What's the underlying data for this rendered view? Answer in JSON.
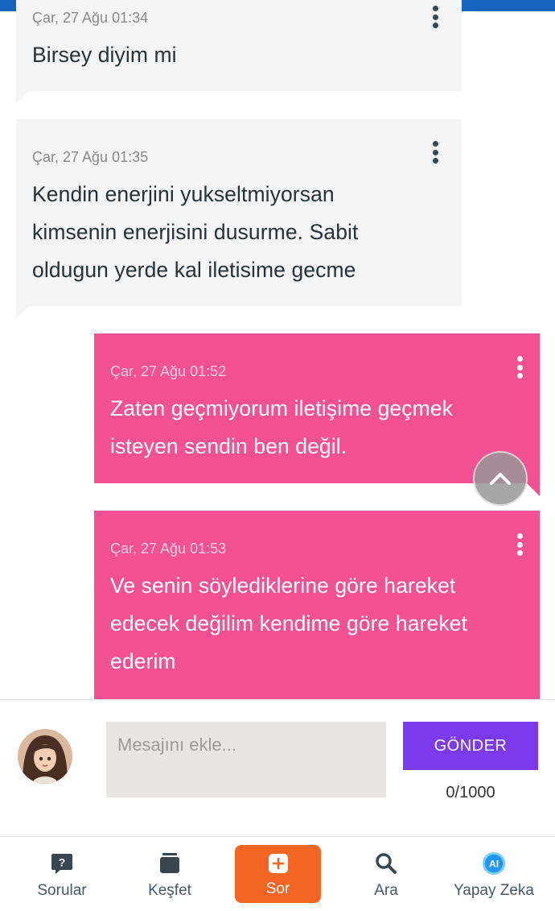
{
  "messages": [
    {
      "direction": "in",
      "time": "Çar, 27 Ağu 01:34",
      "lines": [
        "Birsey diyim mi"
      ]
    },
    {
      "direction": "in",
      "time": "Çar, 27 Ağu 01:35",
      "lines": [
        "Kendin enerjini yukseltmiyorsan",
        "kimsenin enerjisini dusurme. Sabit",
        "oldugun yerde kal iletisime gecme"
      ]
    },
    {
      "direction": "out",
      "time": "Çar, 27 Ağu 01:52",
      "lines": [
        "Zaten geçmiyorum iletişime geçmek",
        "isteyen sendin ben değil."
      ]
    },
    {
      "direction": "out",
      "time": "Çar, 27 Ağu 01:53",
      "lines": [
        "Ve senin söylediklerine göre hareket",
        "edecek değilim kendime göre hareket",
        "ederim"
      ]
    }
  ],
  "composer": {
    "placeholder": "Mesajını ekle...",
    "send_label": "GÖNDER",
    "counter": "0/1000"
  },
  "nav": {
    "items": [
      {
        "label": "Sorular",
        "icon": "question-bubble-icon"
      },
      {
        "label": "Keşfet",
        "icon": "cards-stack-icon"
      },
      {
        "label": "Sor",
        "icon": "plus-square-icon",
        "active": true
      },
      {
        "label": "Ara",
        "icon": "search-icon"
      },
      {
        "label": "Yapay Zeka",
        "icon": "ai-badge-icon"
      }
    ]
  },
  "colors": {
    "incoming_bubble": "#f5f5f5",
    "outgoing_bubble": "#f45193",
    "send_button": "#7c3aed",
    "active_nav": "#f26522",
    "top_bar": "#1565c0"
  }
}
